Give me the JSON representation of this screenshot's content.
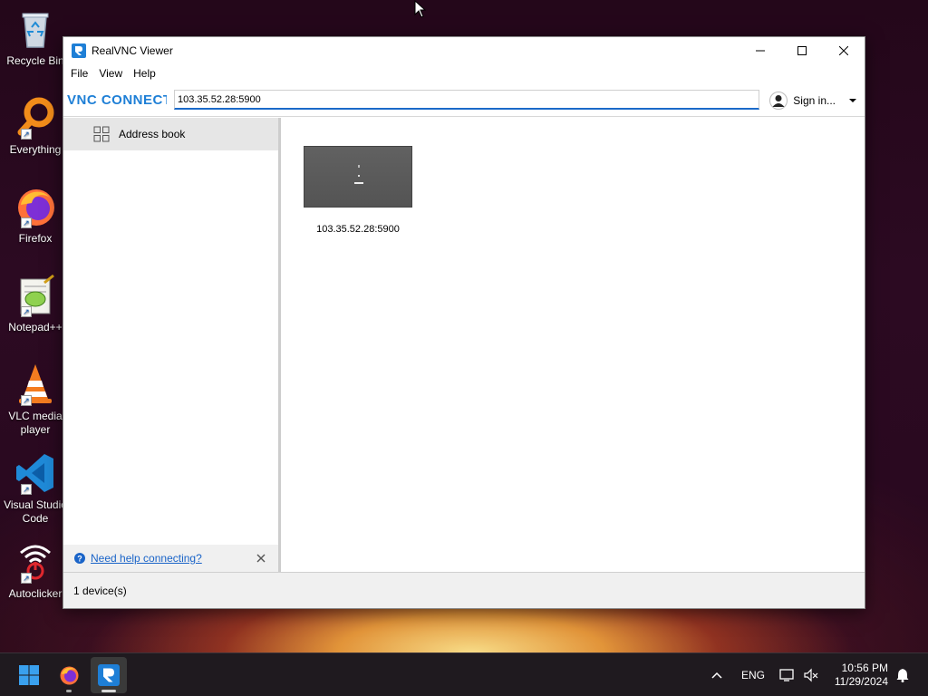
{
  "desktop": {
    "icons": [
      {
        "label": "Recycle Bin",
        "icon": "recycle-bin-icon"
      },
      {
        "label": "Everything",
        "icon": "everything-search-icon"
      },
      {
        "label": "Firefox",
        "icon": "firefox-icon"
      },
      {
        "label": "Notepad++",
        "icon": "notepad-plus-plus-icon"
      },
      {
        "label": "VLC media player",
        "icon": "vlc-icon"
      },
      {
        "label": "Visual Studio Code",
        "icon": "vscode-icon"
      },
      {
        "label": "Autoclicker",
        "icon": "autoclicker-icon"
      }
    ]
  },
  "window": {
    "title": "RealVNC Viewer",
    "menu": [
      "File",
      "View",
      "Help"
    ],
    "logo_text": "VNC CONNECT",
    "address_value": "103.35.52.28:5900",
    "signin_label": "Sign in...",
    "sidebar": {
      "address_book": "Address book",
      "help_link": "Need help connecting?"
    },
    "devices": [
      {
        "label": "103.35.52.28:5900"
      }
    ],
    "status": "1 device(s)"
  },
  "taskbar": {
    "language": "ENG",
    "time": "10:56 PM",
    "date": "11/29/2024"
  },
  "colors": {
    "accent": "#1b6ac9",
    "vnc_logo": "#1e7fd6"
  }
}
